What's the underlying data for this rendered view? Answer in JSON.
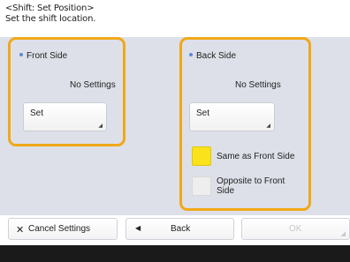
{
  "header": {
    "line1": "<Shift: Set Position>",
    "line2": "Set the shift location."
  },
  "front_side": {
    "title": "Front Side",
    "status": "No Settings",
    "set_label": "Set"
  },
  "back_side": {
    "title": "Back Side",
    "status": "No Settings",
    "set_label": "Set",
    "options": [
      {
        "label": "Same as Front Side",
        "selected": true
      },
      {
        "label": "Opposite to Front Side",
        "selected": false
      }
    ]
  },
  "footer": {
    "cancel_label": "Cancel Settings",
    "back_label": "Back",
    "ok_label": "OK"
  },
  "colors": {
    "highlight": "#f0a818",
    "selected_option": "#fae21c",
    "unselected_option": "#eeeeee",
    "panel_background": "#dde0e8"
  },
  "icons": {
    "title_marker": "bullet-dot-icon",
    "set_corner": "corner-arrow-icon",
    "cancel": "x-icon",
    "back": "left-arrow-icon",
    "ok_corner": "corner-resize-icon"
  }
}
